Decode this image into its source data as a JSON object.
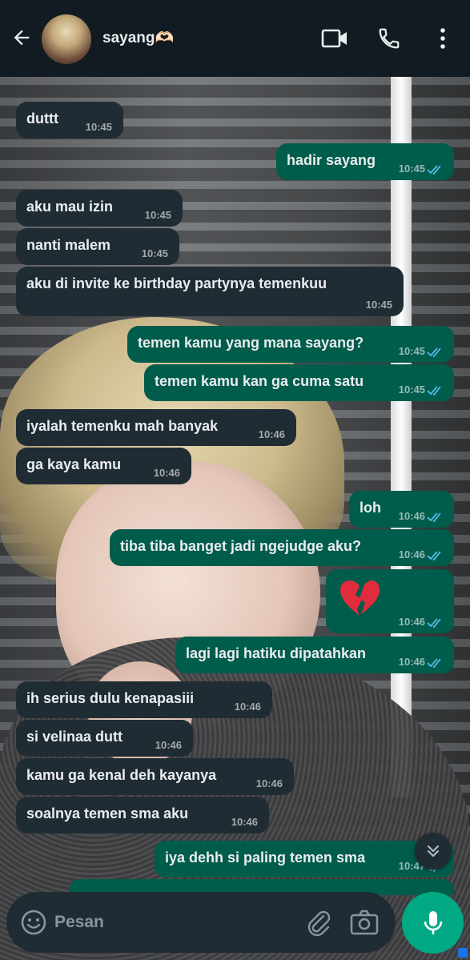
{
  "header": {
    "contact_name": "sayang🫶🏻"
  },
  "messages": [
    {
      "text": "duttt",
      "time": "10:45",
      "dir": "in"
    },
    {
      "text": "hadir sayang",
      "time": "10:45",
      "dir": "out",
      "status": "read"
    },
    {
      "text": "aku mau izin",
      "time": "10:45",
      "dir": "in"
    },
    {
      "text": "nanti malem",
      "time": "10:45",
      "dir": "in"
    },
    {
      "text": "aku di invite ke birthday partynya temenkuu",
      "time": "10:45",
      "dir": "in"
    },
    {
      "text": "temen kamu yang mana sayang?",
      "time": "10:45",
      "dir": "out",
      "status": "read"
    },
    {
      "text": "temen kamu kan ga cuma satu",
      "time": "10:45",
      "dir": "out",
      "status": "read"
    },
    {
      "text": "iyalah temenku mah banyak",
      "time": "10:46",
      "dir": "in"
    },
    {
      "text": "ga kaya kamu",
      "time": "10:46",
      "dir": "in"
    },
    {
      "text": "loh",
      "time": "10:46",
      "dir": "out",
      "status": "read"
    },
    {
      "text": "tiba tiba banget jadi ngejudge aku?",
      "time": "10:46",
      "dir": "out",
      "status": "read"
    },
    {
      "text": "💔",
      "time": "10:46",
      "dir": "out",
      "status": "read",
      "emoji_only": true
    },
    {
      "text": "lagi lagi hatiku dipatahkan",
      "time": "10:46",
      "dir": "out",
      "status": "read"
    },
    {
      "text": "ih serius dulu kenapasiii",
      "time": "10:46",
      "dir": "in"
    },
    {
      "text": "si velinaa dutt",
      "time": "10:46",
      "dir": "in"
    },
    {
      "text": "kamu ga kenal deh kayanya",
      "time": "10:46",
      "dir": "in"
    },
    {
      "text": "soalnya temen sma aku",
      "time": "10:46",
      "dir": "in"
    },
    {
      "text": "iya dehh si paling temen sma",
      "time": "10:47",
      "dir": "out",
      "status": "read"
    }
  ],
  "composer": {
    "placeholder": "Pesan"
  },
  "colors": {
    "header_bg": "#111b21",
    "incoming_bubble": "#202c33",
    "outgoing_bubble": "#005c4b",
    "read_ticks": "#53bdeb",
    "mic_button": "#00a884"
  },
  "icons": {
    "back": "arrow-left-icon",
    "video": "video-camera-icon",
    "call": "phone-icon",
    "menu": "more-vertical-icon",
    "scroll": "chevrons-down-icon",
    "emoji": "emoji-smile-icon",
    "attach": "paperclip-icon",
    "camera": "camera-icon",
    "mic": "microphone-icon"
  }
}
